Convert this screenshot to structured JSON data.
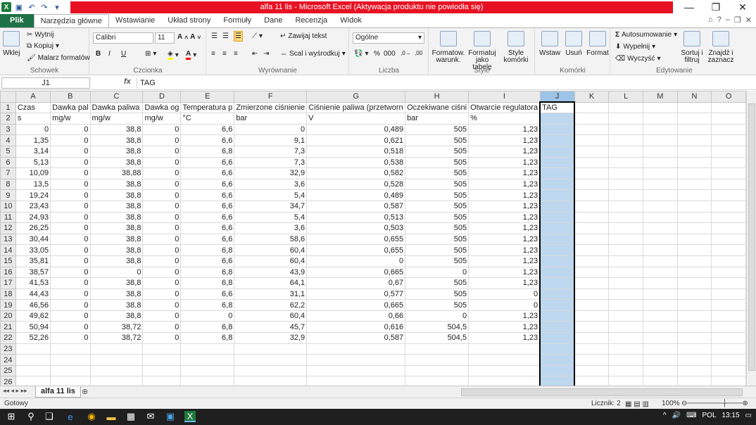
{
  "title": {
    "text": "alfa 11 lis  -  Microsoft Excel (Aktywacja produktu nie powiodła się)"
  },
  "window_controls": {
    "min": "—",
    "restore": "❐",
    "close": "✕"
  },
  "ribbon_tabs": [
    "Plik",
    "Narzędzia główne",
    "Wstawianie",
    "Układ strony",
    "Formuły",
    "Dane",
    "Recenzja",
    "Widok"
  ],
  "ribbon": {
    "clipboard": {
      "paste": "Wklej",
      "cut": "Wytnij",
      "copy": "Kopiuj",
      "painter": "Malarz formatów",
      "label": "Schowek"
    },
    "font": {
      "name": "Calibri",
      "size": "11",
      "label": "Czcionka",
      "bold": "B",
      "italic": "I",
      "underline": "U"
    },
    "alignment": {
      "wrap": "Zawijaj tekst",
      "merge": "Scal i wyśrodkuj",
      "label": "Wyrównanie"
    },
    "number": {
      "format": "Ogólne",
      "label": "Liczba",
      "percent": "%",
      "thousands": "000"
    },
    "styles": {
      "cond": "Formatow. warunk.",
      "table": "Formatuj jako tabelę",
      "cell": "Style komórki",
      "label": "Style"
    },
    "cells": {
      "insert": "Wstaw",
      "delete": "Usuń",
      "format": "Format",
      "label": "Komórki"
    },
    "editing": {
      "autosum": "Autosumowanie",
      "fill": "Wypełnij",
      "clear": "Wyczyść",
      "sort": "Sortuj i filtruj",
      "find": "Znajdź i zaznacz",
      "label": "Edytowanie"
    }
  },
  "formula_bar": {
    "cell_ref": "J1",
    "fx": "fx",
    "content": "TAG"
  },
  "columns": [
    "A",
    "B",
    "C",
    "D",
    "E",
    "F",
    "G",
    "H",
    "I",
    "J",
    "K",
    "L",
    "M",
    "N",
    "O"
  ],
  "rows": [
    [
      "Czas",
      "Dawka pal",
      "Dawka paliwa",
      "Dawka og",
      "Temperatura p",
      "Zmierzone ciśnienie",
      "Ciśnienie paliwa (przetworn",
      "Oczekiwane ciśni",
      "Otwarcie regulatora",
      "TAG",
      "",
      "",
      "",
      "",
      ""
    ],
    [
      "s",
      "mg/w",
      "mg/w",
      "mg/w",
      "°C",
      "bar",
      "V",
      "bar",
      "%",
      "",
      "",
      "",
      "",
      "",
      ""
    ],
    [
      "0",
      "0",
      "38,8",
      "0",
      "6,6",
      "0",
      "0,489",
      "505",
      "1,23",
      "",
      "",
      "",
      "",
      "",
      ""
    ],
    [
      "1,35",
      "0",
      "38,8",
      "0",
      "6,6",
      "9,1",
      "0,621",
      "505",
      "1,23",
      "",
      "",
      "",
      "",
      "",
      ""
    ],
    [
      "3,14",
      "0",
      "38,8",
      "0",
      "6,8",
      "7,3",
      "0,518",
      "505",
      "1,23",
      "",
      "",
      "",
      "",
      "",
      ""
    ],
    [
      "5,13",
      "0",
      "38,8",
      "0",
      "6,6",
      "7,3",
      "0,538",
      "505",
      "1,23",
      "",
      "",
      "",
      "",
      "",
      ""
    ],
    [
      "10,09",
      "0",
      "38,88",
      "0",
      "6,6",
      "32,9",
      "0,582",
      "505",
      "1,23",
      "",
      "",
      "",
      "",
      "",
      ""
    ],
    [
      "13,5",
      "0",
      "38,8",
      "0",
      "6,6",
      "3,6",
      "0,528",
      "505",
      "1,23",
      "",
      "",
      "",
      "",
      "",
      ""
    ],
    [
      "19,24",
      "0",
      "38,8",
      "0",
      "6,6",
      "5,4",
      "0,489",
      "505",
      "1,23",
      "",
      "",
      "",
      "",
      "",
      ""
    ],
    [
      "23,43",
      "0",
      "38,8",
      "0",
      "6,6",
      "34,7",
      "0,587",
      "505",
      "1,23",
      "",
      "",
      "",
      "",
      "",
      ""
    ],
    [
      "24,93",
      "0",
      "38,8",
      "0",
      "6,6",
      "5,4",
      "0,513",
      "505",
      "1,23",
      "",
      "",
      "",
      "",
      "",
      ""
    ],
    [
      "26,25",
      "0",
      "38,8",
      "0",
      "6,6",
      "3,6",
      "0,503",
      "505",
      "1,23",
      "",
      "",
      "",
      "",
      "",
      ""
    ],
    [
      "30,44",
      "0",
      "38,8",
      "0",
      "6,6",
      "58,6",
      "0,655",
      "505",
      "1,23",
      "",
      "",
      "",
      "",
      "",
      ""
    ],
    [
      "33,05",
      "0",
      "38,8",
      "0",
      "6,8",
      "60,4",
      "0,655",
      "505",
      "1,23",
      "",
      "",
      "",
      "",
      "",
      ""
    ],
    [
      "35,81",
      "0",
      "38,8",
      "0",
      "6,6",
      "60,4",
      "0",
      "505",
      "1,23",
      "",
      "",
      "",
      "",
      "",
      ""
    ],
    [
      "38,57",
      "0",
      "0",
      "0",
      "6,8",
      "43,9",
      "0,665",
      "0",
      "1,23",
      "",
      "",
      "",
      "",
      "",
      ""
    ],
    [
      "41,53",
      "0",
      "38,8",
      "0",
      "6,8",
      "64,1",
      "0,67",
      "505",
      "1,23",
      "",
      "",
      "",
      "",
      "",
      ""
    ],
    [
      "44,43",
      "0",
      "38,8",
      "0",
      "6,6",
      "31,1",
      "0,577",
      "505",
      "0",
      "",
      "",
      "",
      "",
      "",
      ""
    ],
    [
      "46,56",
      "0",
      "38,8",
      "0",
      "6,8",
      "62,2",
      "0,665",
      "505",
      "0",
      "",
      "",
      "",
      "",
      "",
      ""
    ],
    [
      "49,62",
      "0",
      "38,8",
      "0",
      "0",
      "60,4",
      "0,66",
      "0",
      "1,23",
      "",
      "",
      "",
      "",
      "",
      ""
    ],
    [
      "50,94",
      "0",
      "38,72",
      "0",
      "6,8",
      "45,7",
      "0,616",
      "504,5",
      "1,23",
      "",
      "",
      "",
      "",
      "",
      ""
    ],
    [
      "52,26",
      "0",
      "38,72",
      "0",
      "6,8",
      "32,9",
      "0,587",
      "504,5",
      "1,23",
      "",
      "",
      "",
      "",
      "",
      ""
    ],
    [
      "",
      "",
      "",
      "",
      "",
      "",
      "",
      "",
      "",
      "",
      "",
      "",
      "",
      "",
      ""
    ],
    [
      "",
      "",
      "",
      "",
      "",
      "",
      "",
      "",
      "",
      "",
      "",
      "",
      "",
      "",
      ""
    ],
    [
      "",
      "",
      "",
      "",
      "",
      "",
      "",
      "",
      "",
      "",
      "",
      "",
      "",
      "",
      ""
    ],
    [
      "",
      "",
      "",
      "",
      "",
      "",
      "",
      "",
      "",
      "",
      "",
      "",
      "",
      "",
      ""
    ]
  ],
  "sheet_tab": "alfa 11 lis",
  "status": {
    "ready": "Gotowy",
    "count": "Licznik: 2",
    "zoom": "100%"
  },
  "taskbar": {
    "lang": "POL",
    "time": "13:15"
  }
}
